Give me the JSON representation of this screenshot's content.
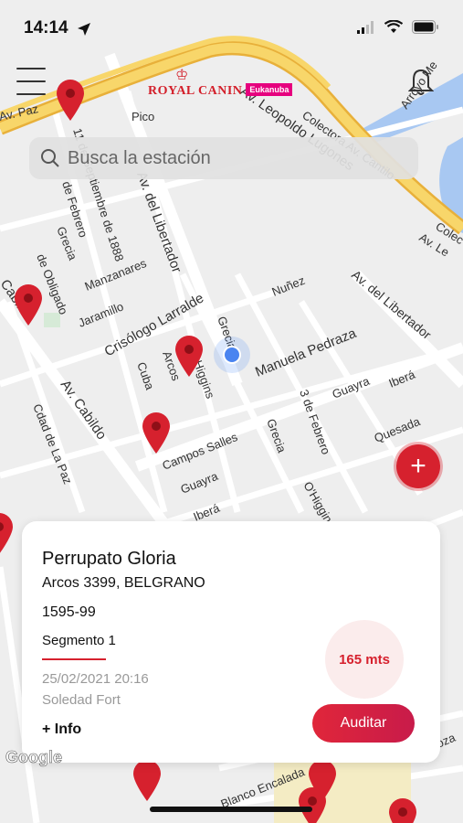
{
  "status_bar": {
    "time": "14:14"
  },
  "header": {
    "brand_primary": "ROYAL CANIN",
    "brand_secondary": "Eukanuba"
  },
  "search": {
    "placeholder": "Busca la estación"
  },
  "map": {
    "street_labels": [
      "Av. Paz",
      "Pico",
      "11 de Septiembre de 1888",
      "Av. del Libertador",
      "Av. Leopoldo Lugones",
      "Colectora Av. Cantilo",
      "Arroyo Me",
      "Av. Le",
      "de Febrero",
      "Grecia",
      "de Obligado",
      "Manzanares",
      "Jaramillo",
      "Crisólogo Larralde",
      "Nuñez",
      "Av. del Libertador",
      "Grecia",
      "Manuela Pedraza",
      "Arcos",
      "Higgins",
      "Cuba",
      "Guayra",
      "Iberá",
      "3 de Febrero",
      "Av. Cabildo",
      "Cabildo",
      "Cdad de La Paz",
      "Campos Salles",
      "Guayra",
      "Grecia",
      "Quesada",
      "O'Higgins",
      "Iberá",
      "Blanco Encalada",
      "Mendoza",
      "Colec"
    ],
    "attribution": "Google"
  },
  "card": {
    "name": "Perrupato Gloria",
    "address": "Arcos 3399, BELGRANO",
    "code": "1595-99",
    "segment": "Segmento 1",
    "datetime": "25/02/2021 20:16",
    "auditor": "Soledad Fort",
    "info_link": "+ Info",
    "distance": "165 mts",
    "audit_button": "Auditar"
  },
  "colors": {
    "accent": "#d6212e",
    "highway": "#f5c54a",
    "water": "#a8c8f2"
  },
  "icons": [
    "location-arrow-icon",
    "signal-icon",
    "wifi-icon",
    "battery-icon",
    "menu-icon",
    "bell-icon",
    "search-icon",
    "plus-icon",
    "map-pin-icon",
    "user-location-icon"
  ]
}
